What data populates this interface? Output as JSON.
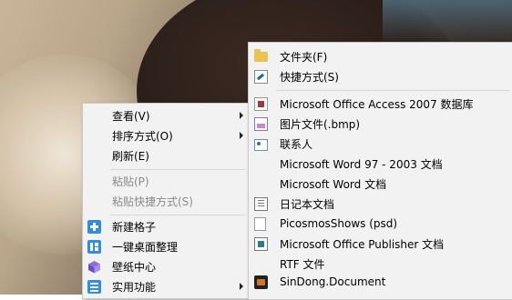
{
  "context_menu": {
    "items": [
      {
        "label": "查看(V)",
        "has_submenu": true,
        "enabled": true
      },
      {
        "label": "排序方式(O)",
        "has_submenu": true,
        "enabled": true
      },
      {
        "label": "刷新(E)",
        "has_submenu": false,
        "enabled": true
      },
      {
        "label": "粘贴(P)",
        "has_submenu": false,
        "enabled": false
      },
      {
        "label": "粘贴快捷方式(S)",
        "has_submenu": false,
        "enabled": false
      },
      {
        "label": "新建格子",
        "icon": "plus-square-icon",
        "has_submenu": false,
        "enabled": true
      },
      {
        "label": "一键桌面整理",
        "icon": "layout-icon",
        "has_submenu": false,
        "enabled": true
      },
      {
        "label": "壁纸中心",
        "icon": "cube-icon",
        "has_submenu": false,
        "enabled": true
      },
      {
        "label": "实用功能",
        "icon": "tools-icon",
        "has_submenu": true,
        "enabled": true
      }
    ]
  },
  "new_submenu": {
    "items": [
      {
        "label": "文件夹(F)",
        "icon": "folder-icon"
      },
      {
        "label": "快捷方式(S)",
        "icon": "shortcut-icon"
      },
      {
        "label": "Microsoft Office Access 2007 数据库",
        "icon": "access-icon"
      },
      {
        "label": "图片文件(.bmp)",
        "icon": "bitmap-icon"
      },
      {
        "label": "联系人",
        "icon": "contact-icon"
      },
      {
        "label": "Microsoft Word 97 - 2003 文档",
        "icon": "none"
      },
      {
        "label": "Microsoft Word 文档",
        "icon": "none"
      },
      {
        "label": "日记本文档",
        "icon": "journal-icon"
      },
      {
        "label": "PicosmosShows (psd)",
        "icon": "document-icon"
      },
      {
        "label": "Microsoft Office Publisher 文档",
        "icon": "publisher-icon"
      },
      {
        "label": "RTF 文件",
        "icon": "none"
      },
      {
        "label": "SinDong.Document",
        "icon": "sindong-icon"
      }
    ]
  },
  "colors": {
    "menu_bg": "#f2f2f2",
    "accent_blue": "#2f8de4",
    "disabled_text": "#8a8a8a"
  }
}
